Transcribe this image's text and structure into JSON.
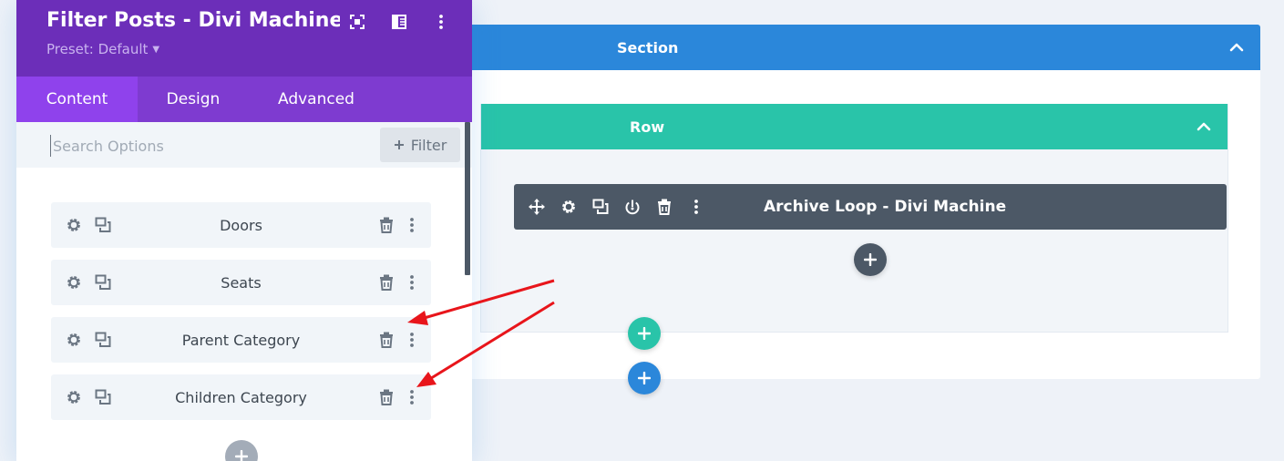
{
  "canvas": {
    "section": {
      "label": "Section",
      "color": "#2b87da"
    },
    "row": {
      "label": "Row",
      "color": "#29c4a9"
    },
    "module": {
      "label": "Archive Loop - Divi Machine",
      "color": "#4c5866",
      "tools": [
        "move-icon",
        "gear-icon",
        "duplicate-icon",
        "power-icon",
        "trash-icon",
        "more-icon"
      ]
    },
    "buttons": [
      "add-module-button",
      "add-row-button",
      "add-section-button"
    ]
  },
  "modal": {
    "title": "Filter Posts - Divi Machine S...",
    "preset": "Preset: Default",
    "header_icons": [
      "fullscreen-icon",
      "split-view-icon",
      "more-icon"
    ],
    "header_color": "#6c2eb9",
    "tabs": [
      {
        "label": "Content",
        "active": true
      },
      {
        "label": "Design",
        "active": false
      },
      {
        "label": "Advanced",
        "active": false
      }
    ],
    "search": {
      "placeholder": "Search Options",
      "value": ""
    },
    "filter_label": "Filter",
    "items": [
      {
        "label": "Doors"
      },
      {
        "label": "Seats"
      },
      {
        "label": "Parent Category"
      },
      {
        "label": "Children Category"
      }
    ],
    "add_item_icon": "plus-icon"
  },
  "annotations": {
    "arrow_color": "#e8151b",
    "arrow_count": 2
  }
}
